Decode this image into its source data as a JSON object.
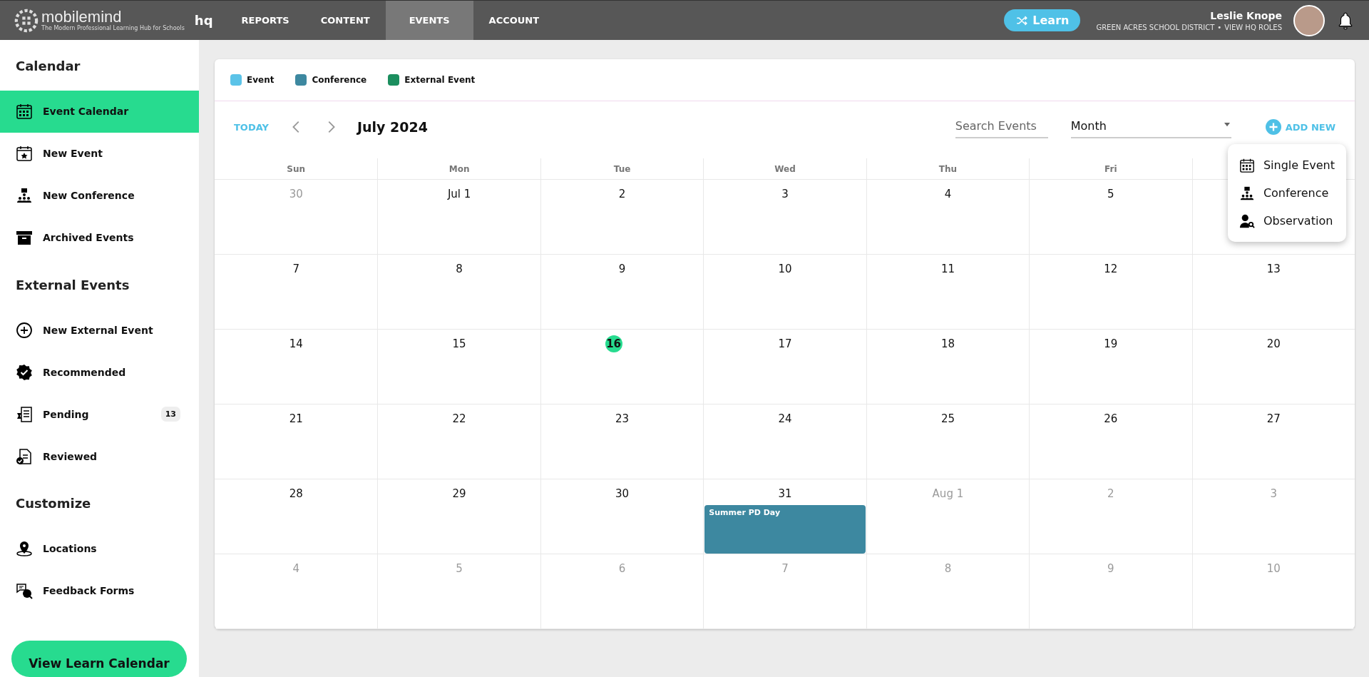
{
  "top_bar": {
    "logo": {
      "name": "mobilemind",
      "tagline": "The Modern Professional Learning Hub for Schools",
      "suffix": "hq"
    },
    "nav": [
      {
        "label": "REPORTS",
        "selected": false
      },
      {
        "label": "CONTENT",
        "selected": false
      },
      {
        "label": "EVENTS",
        "selected": true
      },
      {
        "label": "ACCOUNT",
        "selected": false
      }
    ],
    "learn_button": "Learn",
    "user": {
      "name": "Leslie Knope",
      "district": "GREEN ACRES SCHOOL DISTRICT",
      "separator": "•",
      "roles_link": "VIEW HQ ROLES"
    }
  },
  "sidebar": {
    "sections": [
      {
        "title": "Calendar",
        "items": [
          {
            "label": "Event Calendar",
            "selected": true
          },
          {
            "label": "New Event",
            "selected": false
          },
          {
            "label": "New Conference",
            "selected": false
          },
          {
            "label": "Archived Events",
            "selected": false
          }
        ]
      },
      {
        "title": "External Events",
        "items": [
          {
            "label": "New External Event",
            "selected": false
          },
          {
            "label": "Recommended",
            "selected": false
          },
          {
            "label": "Pending",
            "selected": false,
            "badge": "13"
          },
          {
            "label": "Reviewed",
            "selected": false
          }
        ]
      },
      {
        "title": "Customize",
        "items": [
          {
            "label": "Locations",
            "selected": false
          },
          {
            "label": "Feedback Forms",
            "selected": false
          }
        ]
      }
    ],
    "footer_button": "View Learn Calendar"
  },
  "calendar": {
    "legend": [
      {
        "label": "Event",
        "color": "#5bc3e8"
      },
      {
        "label": "Conference",
        "color": "#3d88a0"
      },
      {
        "label": "External Event",
        "color": "#1b8e5e"
      }
    ],
    "today_button": "TODAY",
    "title": "July 2024",
    "search": {
      "placeholder": "Search Events"
    },
    "view_select": {
      "value": "Month"
    },
    "add_new": "ADD NEW",
    "add_menu": [
      "Single Event",
      "Conference",
      "Observation"
    ],
    "weekdays": [
      "Sun",
      "Mon",
      "Tue",
      "Wed",
      "Thu",
      "Fri"
    ],
    "weeks": [
      {
        "days": [
          {
            "label": "30",
            "muted": true
          },
          {
            "label": "Jul 1",
            "muted": false
          },
          {
            "label": "2",
            "muted": false
          },
          {
            "label": "3",
            "muted": false
          },
          {
            "label": "4",
            "muted": false
          },
          {
            "label": "5",
            "muted": false
          }
        ]
      },
      {
        "days": [
          {
            "label": "7",
            "muted": false
          },
          {
            "label": "8",
            "muted": false
          },
          {
            "label": "9",
            "muted": false
          },
          {
            "label": "10",
            "muted": false
          },
          {
            "label": "11",
            "muted": false
          },
          {
            "label": "12",
            "muted": false
          },
          {
            "label": "13",
            "muted": false
          }
        ]
      },
      {
        "days": [
          {
            "label": "14",
            "muted": false
          },
          {
            "label": "15",
            "muted": false
          },
          {
            "label": "16",
            "muted": false,
            "today": true
          },
          {
            "label": "17",
            "muted": false
          },
          {
            "label": "18",
            "muted": false
          },
          {
            "label": "19",
            "muted": false
          },
          {
            "label": "20",
            "muted": false
          }
        ]
      },
      {
        "days": [
          {
            "label": "21",
            "muted": false
          },
          {
            "label": "22",
            "muted": false
          },
          {
            "label": "23",
            "muted": false
          },
          {
            "label": "24",
            "muted": false
          },
          {
            "label": "25",
            "muted": false
          },
          {
            "label": "26",
            "muted": false
          },
          {
            "label": "27",
            "muted": false
          }
        ]
      },
      {
        "days": [
          {
            "label": "28",
            "muted": false
          },
          {
            "label": "29",
            "muted": false
          },
          {
            "label": "30",
            "muted": false
          },
          {
            "label": "31",
            "muted": false,
            "events": [
              {
                "title": "Summer PD Day",
                "color": "#3d88a0"
              }
            ]
          },
          {
            "label": "Aug 1",
            "muted": true
          },
          {
            "label": "2",
            "muted": true
          },
          {
            "label": "3",
            "muted": true
          }
        ]
      },
      {
        "days": [
          {
            "label": "4",
            "muted": true
          },
          {
            "label": "5",
            "muted": true
          },
          {
            "label": "6",
            "muted": true
          },
          {
            "label": "7",
            "muted": true
          },
          {
            "label": "8",
            "muted": true
          },
          {
            "label": "9",
            "muted": true
          },
          {
            "label": "10",
            "muted": true
          }
        ]
      }
    ]
  }
}
